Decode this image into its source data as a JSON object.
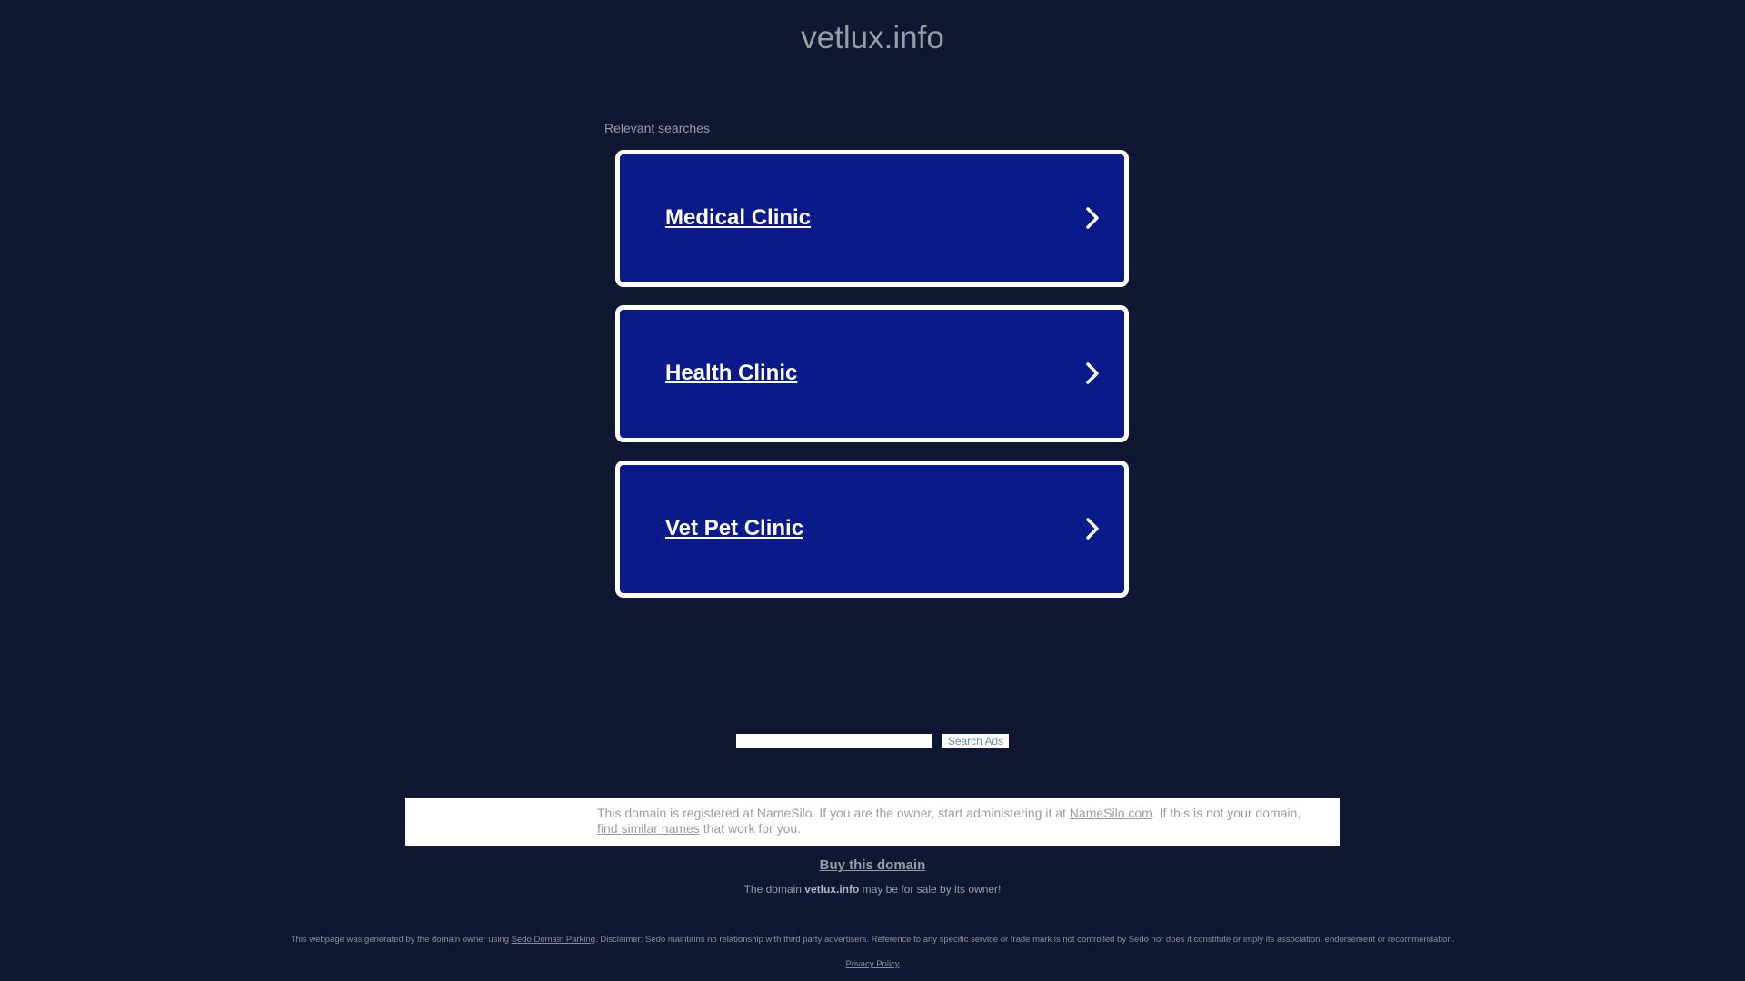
{
  "header": {
    "domain": "vetlux.info"
  },
  "relevant_searches": {
    "label": "Relevant searches",
    "items": [
      {
        "label": "Medical Clinic"
      },
      {
        "label": "Health Clinic"
      },
      {
        "label": "Vet Pet Clinic"
      }
    ]
  },
  "search": {
    "value": "",
    "button_label": "Search Ads"
  },
  "notice": {
    "text_1": "This domain is registered at NameSilo. If you are the owner, start administering it at ",
    "link_1": "NameSilo.com",
    "text_2": ". If this is not your domain, ",
    "link_2": "find similar names",
    "text_3": " that work for you."
  },
  "sale": {
    "buy_label": "Buy this domain",
    "prefix": "The domain ",
    "domain": "vetlux.info",
    "suffix": " may be for sale by its owner!"
  },
  "footer": {
    "disclaimer_prefix": "This webpage was generated by the domain owner using ",
    "disclaimer_link": "Sedo Domain Parking",
    "disclaimer_suffix": ". Disclaimer: Sedo maintains no relationship with third party advertisers. Reference to any specific service or trade mark is not controlled by Sedo nor does it constitute or imply its association, endorsement or recommendation.",
    "privacy_label": "Privacy Policy"
  },
  "colors": {
    "background": "#0f1733",
    "card_fill": "#0b1a8a",
    "card_border": "#ffffff",
    "muted_text": "#9a9ca3"
  },
  "icons": {
    "card_arrow": "chevron-right-icon"
  }
}
